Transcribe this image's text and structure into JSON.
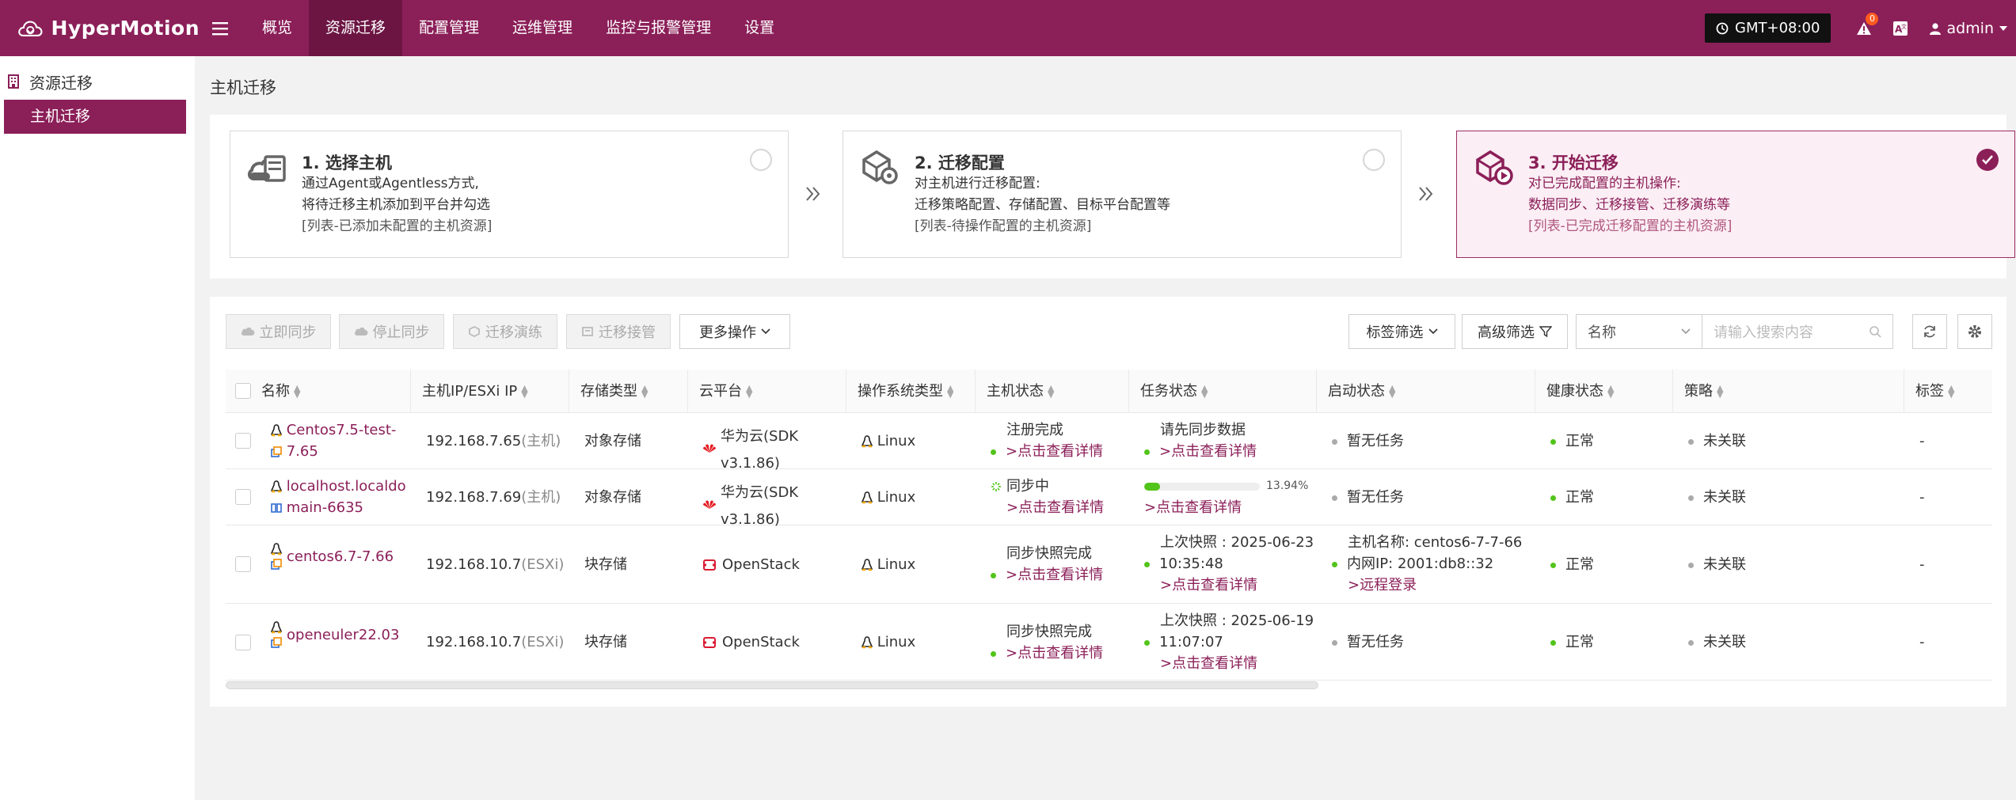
{
  "app": {
    "name": "HyperMotion"
  },
  "nav": {
    "items": [
      "概览",
      "资源迁移",
      "配置管理",
      "运维管理",
      "监控与报警管理",
      "设置"
    ],
    "active_index": 1
  },
  "header": {
    "timezone": "GMT+08:00",
    "alert_count": "0",
    "user": "admin"
  },
  "sidebar": {
    "group_label": "资源迁移",
    "active_item": "主机迁移"
  },
  "page": {
    "title": "主机迁移"
  },
  "steps": [
    {
      "title": "1. 选择主机",
      "line1": "通过Agent或Agentless方式,",
      "line2": "将待迁移主机添加到平台并勾选",
      "line3": "[列表-已添加未配置的主机资源]",
      "state": "pending"
    },
    {
      "title": "2. 迁移配置",
      "line1": "对主机进行迁移配置:",
      "line2": "迁移策略配置、存储配置、目标平台配置等",
      "line3": "[列表-待操作配置的主机资源]",
      "state": "pending"
    },
    {
      "title": "3. 开始迁移",
      "line1": "对已完成配置的主机操作:",
      "line2": "数据同步、迁移接管、迁移演练等",
      "line3": "[列表-已完成迁移配置的主机资源]",
      "state": "done"
    }
  ],
  "toolbar": {
    "sync_now": "立即同步",
    "stop_sync": "停止同步",
    "drill": "迁移演练",
    "takeover": "迁移接管",
    "more": "更多操作",
    "tag_filter": "标签筛选",
    "adv_filter": "高级筛选",
    "search_field": "名称",
    "search_placeholder": "请输入搜索内容"
  },
  "table": {
    "columns": [
      "名称",
      "主机IP/ESXi IP",
      "存储类型",
      "云平台",
      "操作系统类型",
      "主机状态",
      "任务状态",
      "启动状态",
      "健康状态",
      "策略",
      "标签"
    ],
    "rows": [
      {
        "name_l1": "Centos7.5-test-",
        "name_l2": "7.65",
        "ip": "192.168.7.65",
        "ip_type": "(主机)",
        "storage": "对象存储",
        "cloud_l1": "华为云(SDK",
        "cloud_l2": "v3.1.86)",
        "cloud_icon": "huawei-icon",
        "os": "Linux",
        "host_status": "注册完成",
        "host_link": ">点击查看详情",
        "task_l1": "请先同步数据",
        "task_l2": "",
        "task_link": ">点击查看详情",
        "boot_l1": "暂无任务",
        "boot_l2": "",
        "boot_l3": "",
        "health": "正常",
        "policy": "未关联",
        "tag": "-"
      },
      {
        "name_l1": "localhost.localdo",
        "name_l2": "main-6635",
        "ip": "192.168.7.69",
        "ip_type": "(主机)",
        "storage": "对象存储",
        "cloud_l1": "华为云(SDK",
        "cloud_l2": "v3.1.86)",
        "cloud_icon": "huawei-icon",
        "os": "Linux",
        "host_status": "同步中",
        "host_link": ">点击查看详情",
        "progress": 13.94,
        "progress_text": "13.94%",
        "task_link": ">点击查看详情",
        "boot_l1": "暂无任务",
        "health": "正常",
        "policy": "未关联",
        "tag": "-"
      },
      {
        "name_l1": "centos6.7-7.66",
        "name_l2": "",
        "ip": "192.168.10.7",
        "ip_type": "(ESXi)",
        "storage": "块存储",
        "cloud_l1": "OpenStack",
        "cloud_l2": "",
        "cloud_icon": "openstack-icon",
        "os": "Linux",
        "host_status": "同步快照完成",
        "host_link": ">点击查看详情",
        "task_l1": "上次快照 : 2025-06-23",
        "task_l2": "10:35:48",
        "task_link": ">点击查看详情",
        "boot_l1": "主机名称: centos6-7-7-66",
        "boot_l2": "内网IP: 2001:db8::32",
        "boot_l3": ">远程登录",
        "health": "正常",
        "policy": "未关联",
        "tag": "-"
      },
      {
        "name_l1": "openeuler22.03",
        "name_l2": "",
        "ip": "192.168.10.7",
        "ip_type": "(ESXi)",
        "storage": "块存储",
        "cloud_l1": "OpenStack",
        "cloud_l2": "",
        "cloud_icon": "openstack-icon",
        "os": "Linux",
        "host_status": "同步快照完成",
        "host_link": ">点击查看详情",
        "task_l1": "上次快照 : 2025-06-19",
        "task_l2": "11:07:07",
        "task_link": ">点击查看详情",
        "boot_l1": "暂无任务",
        "boot_l2": "",
        "boot_l3": "",
        "health": "正常",
        "policy": "未关联",
        "tag": "-"
      }
    ]
  },
  "colors": {
    "brand": "#8b1f58",
    "success": "#52c41a",
    "neutral": "#aaaaaa"
  }
}
